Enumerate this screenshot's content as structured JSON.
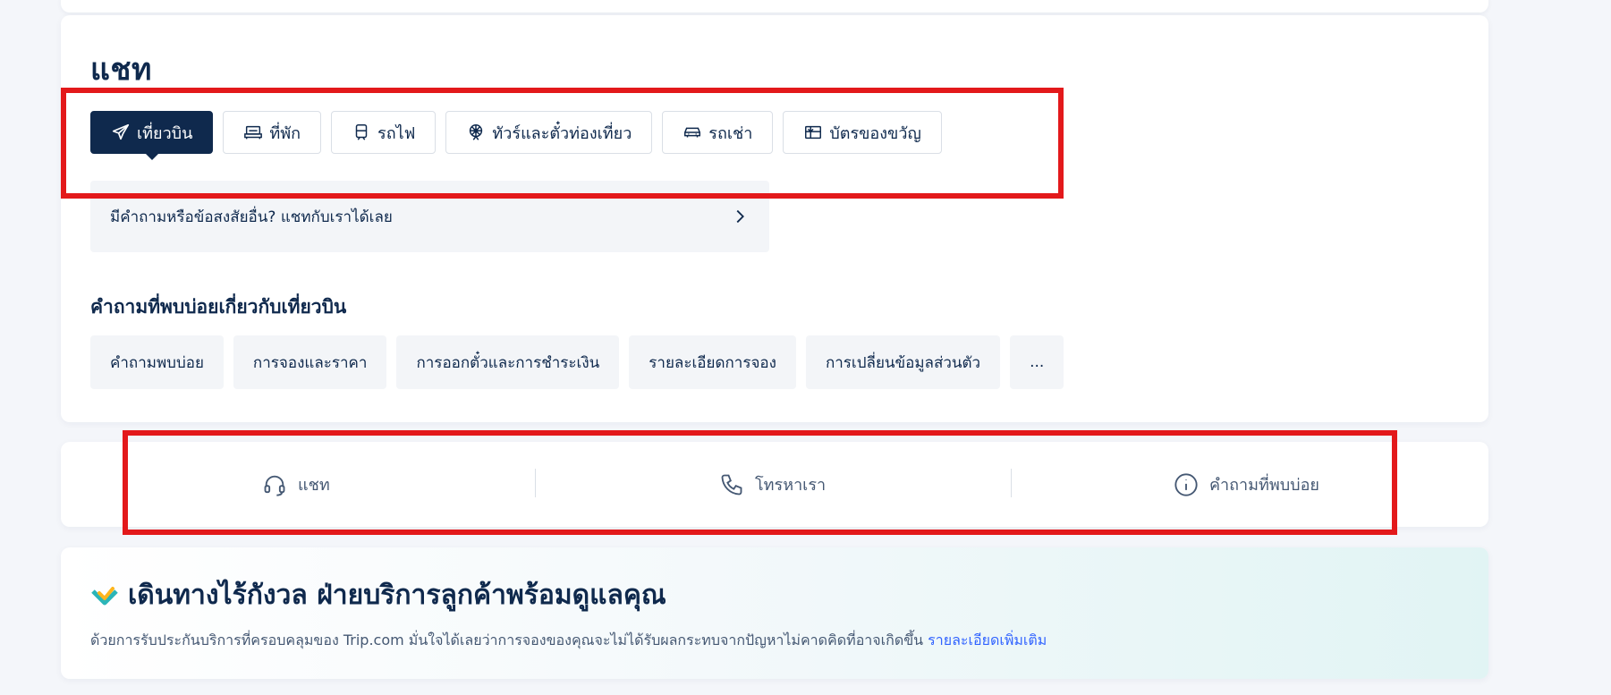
{
  "chat": {
    "title": "แชท",
    "tabs": [
      {
        "label": "เที่ยวบิน",
        "icon": "airplane-icon",
        "active": true
      },
      {
        "label": "ที่พัก",
        "icon": "bed-icon"
      },
      {
        "label": "รถไฟ",
        "icon": "train-icon"
      },
      {
        "label": "ทัวร์และตั๋วท่องเที่ยว",
        "icon": "ferris-wheel-icon"
      },
      {
        "label": "รถเช่า",
        "icon": "car-icon"
      },
      {
        "label": "บัตรของขวัญ",
        "icon": "gift-card-icon"
      }
    ],
    "chat_link": "มีคำถามหรือข้อสงสัยอื่น? แชทกับเราได้เลย"
  },
  "faq": {
    "title": "คำถามที่พบบ่อยเกี่ยวกับเที่ยวบิน",
    "chips": [
      "คำถามพบบ่อย",
      "การจองและราคา",
      "การออกตั๋วและการชำระเงิน",
      "รายละเอียดการจอง",
      "การเปลี่ยนข้อมูลส่วนตัว",
      "..."
    ]
  },
  "contact": {
    "chat": {
      "label": "แชท",
      "icon": "headset-icon"
    },
    "call": {
      "label": "โทรหาเรา",
      "icon": "phone-icon"
    },
    "faq": {
      "label": "คำถามที่พบบ่อย",
      "icon": "info-icon"
    }
  },
  "promo": {
    "title": "เดินทางไร้กังวล ฝ่ายบริการลูกค้าพร้อมดูแลคุณ",
    "text": "ด้วยการรับประกันบริการที่ครอบคลุมของ Trip.com มั่นใจได้เลยว่าการจองของคุณจะไม่ได้รับผลกระทบจากปัญหาไม่คาดคิดที่อาจเกิดขึ้น",
    "link": "รายละเอียดเพิ่มเติม",
    "icon": "heart-check-icon"
  },
  "colors": {
    "primary": "#0f294d",
    "link": "#3264ff",
    "highlight": "#e3191b",
    "teal": "#2bb5b8",
    "yellow": "#ffb51c"
  }
}
